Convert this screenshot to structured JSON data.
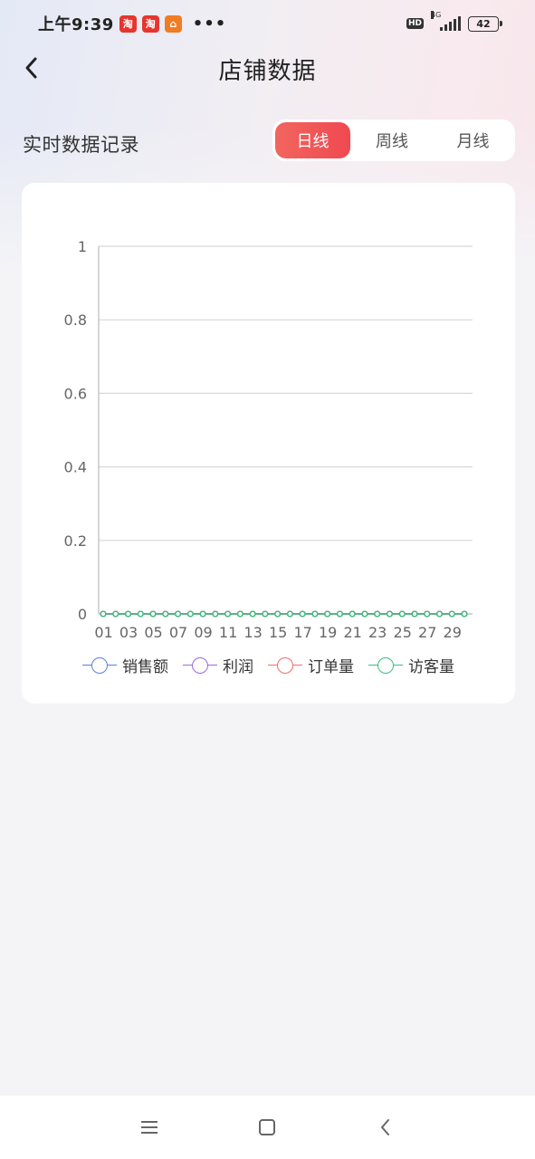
{
  "status_bar": {
    "time": "上午9:39",
    "app_icons": [
      {
        "name": "taobao-icon",
        "glyph": "淘",
        "color": "#e7352e"
      },
      {
        "name": "taobao-icon",
        "glyph": "淘",
        "color": "#e7352e"
      },
      {
        "name": "home-app-icon",
        "glyph": "⌂",
        "color": "#f27c22"
      }
    ],
    "more": "•••",
    "hd": "HD",
    "network": "4G",
    "battery": "42"
  },
  "header": {
    "title": "店铺数据"
  },
  "section": {
    "title": "实时数据记录",
    "tabs": [
      {
        "label": "日线",
        "active": true
      },
      {
        "label": "周线",
        "active": false
      },
      {
        "label": "月线",
        "active": false
      }
    ]
  },
  "chart_data": {
    "type": "line",
    "x": [
      "01",
      "02",
      "03",
      "04",
      "05",
      "06",
      "07",
      "08",
      "09",
      "10",
      "11",
      "12",
      "13",
      "14",
      "15",
      "16",
      "17",
      "18",
      "19",
      "20",
      "21",
      "22",
      "23",
      "24",
      "25",
      "26",
      "27",
      "28",
      "29",
      "30"
    ],
    "x_tick_labels": [
      "01",
      "03",
      "05",
      "07",
      "09",
      "11",
      "13",
      "15",
      "17",
      "19",
      "21",
      "23",
      "25",
      "27",
      "29"
    ],
    "ylim": [
      0,
      1
    ],
    "y_ticks": [
      "0",
      "0.2",
      "0.4",
      "0.6",
      "0.8",
      "1"
    ],
    "grid": true,
    "legend_position": "bottom",
    "series": [
      {
        "name": "销售额",
        "color": "#5b7fe0",
        "values": [
          0,
          0,
          0,
          0,
          0,
          0,
          0,
          0,
          0,
          0,
          0,
          0,
          0,
          0,
          0,
          0,
          0,
          0,
          0,
          0,
          0,
          0,
          0,
          0,
          0,
          0,
          0,
          0,
          0,
          0
        ]
      },
      {
        "name": "利润",
        "color": "#9b6ae0",
        "values": [
          0,
          0,
          0,
          0,
          0,
          0,
          0,
          0,
          0,
          0,
          0,
          0,
          0,
          0,
          0,
          0,
          0,
          0,
          0,
          0,
          0,
          0,
          0,
          0,
          0,
          0,
          0,
          0,
          0,
          0
        ]
      },
      {
        "name": "订单量",
        "color": "#ee6f6a",
        "values": [
          0,
          0,
          0,
          0,
          0,
          0,
          0,
          0,
          0,
          0,
          0,
          0,
          0,
          0,
          0,
          0,
          0,
          0,
          0,
          0,
          0,
          0,
          0,
          0,
          0,
          0,
          0,
          0,
          0,
          0
        ]
      },
      {
        "name": "访客量",
        "color": "#3dbd7d",
        "values": [
          0,
          0,
          0,
          0,
          0,
          0,
          0,
          0,
          0,
          0,
          0,
          0,
          0,
          0,
          0,
          0,
          0,
          0,
          0,
          0,
          0,
          0,
          0,
          0,
          0,
          0,
          0,
          0,
          0,
          0
        ]
      }
    ]
  },
  "system_nav": {
    "icons": [
      "menu-icon",
      "home-square-icon",
      "back-chevron-icon"
    ]
  }
}
